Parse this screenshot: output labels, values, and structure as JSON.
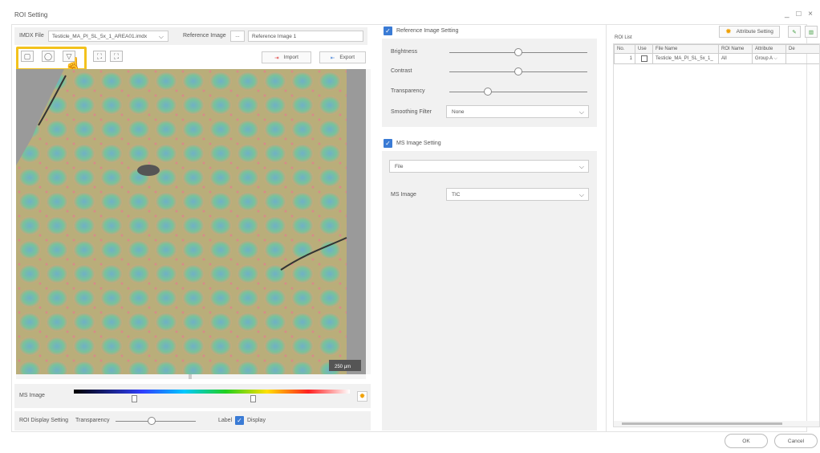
{
  "window": {
    "title": "ROI Setting",
    "controls": "_ □ ×"
  },
  "top_bar": {
    "msi_file_label": "IMDX File",
    "msi_file_value": "Testicle_MA_PI_SL_5x_1_AREA01.imdx",
    "reference_label": "Reference Image",
    "reference_browse": "...",
    "reference_value": "Reference Image 1"
  },
  "toolbar": {
    "tools": [
      "rectangle-tool-icon",
      "ellipse-tool-icon",
      "polygon-tool-icon",
      "fit-icon",
      "zoom-fit-icon"
    ],
    "import_label": "Import",
    "export_label": "Export",
    "highlight_color": "#f3c21c"
  },
  "image_view": {
    "scale_bar": "250 µm"
  },
  "ms_image_bar": {
    "label": "MS Image",
    "low_knob": 0.22,
    "high_knob": 0.65
  },
  "roi_display": {
    "label": "ROI Display Setting",
    "transparency_label": "Transparency",
    "transparency_value": 0.45,
    "label_label": "Label",
    "display_label": "Display"
  },
  "reference_setting": {
    "title": "Reference Image Setting",
    "brightness_label": "Brightness",
    "brightness_value": 0.5,
    "contrast_label": "Contrast",
    "contrast_value": 0.5,
    "transparency_label": "Transparency",
    "transparency_value": 0.28,
    "smoothing_label": "Smoothing Filter",
    "smoothing_value": "None"
  },
  "ms_setting": {
    "title": "MS Image Setting",
    "source_value": "File",
    "ms_image_label": "MS Image",
    "ms_image_value": "TIC"
  },
  "roi_list": {
    "title": "ROI List",
    "attribute_button": "Attribute Setting",
    "columns": [
      "No.",
      "Use",
      "File Name",
      "ROI Name",
      "Attribute",
      "De"
    ],
    "rows": [
      {
        "no": "1",
        "file": "Testicle_MA_PI_SL_5x_1_",
        "roi": "All",
        "attribute": "Group A"
      }
    ]
  },
  "footer": {
    "ok": "OK",
    "cancel": "Cancel"
  }
}
